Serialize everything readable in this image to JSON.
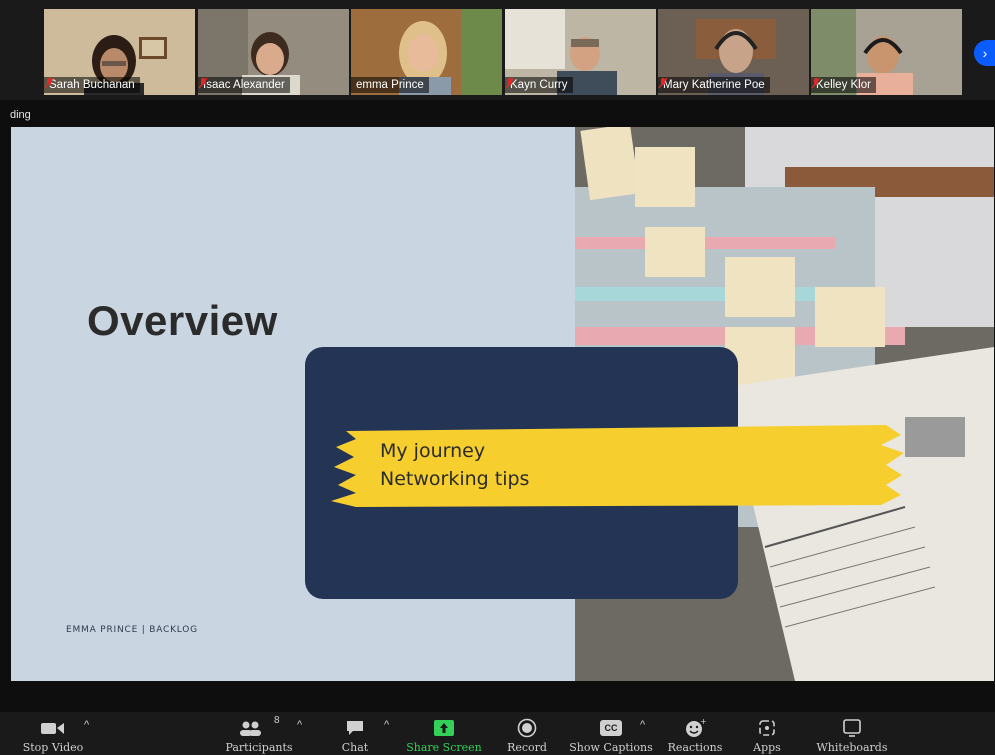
{
  "participants": [
    {
      "name": "Sarah Buchanan",
      "muted": true,
      "bg": "#c9b79a"
    },
    {
      "name": "Isaac Alexander",
      "muted": true,
      "bg": "#8f8a7e"
    },
    {
      "name": "emma Prince",
      "muted": false,
      "bg": "#9b6a3c"
    },
    {
      "name": "Kayn Curry",
      "muted": true,
      "bg": "#b9b3a3"
    },
    {
      "name": "Mary Katherine Poe",
      "muted": true,
      "bg": "#6e6255"
    },
    {
      "name": "Kelley Klor",
      "muted": true,
      "bg": "#a7a295"
    }
  ],
  "strip": {
    "next_arrow": "›"
  },
  "recording_label": "ding",
  "slide": {
    "title": "Overview",
    "items": [
      "My journey",
      "Networking tips"
    ],
    "footer": "EMMA PRINCE | BACKLOG"
  },
  "toolbar": {
    "stop_video": "Stop Video",
    "participants": "Participants",
    "participants_count": "8",
    "chat": "Chat",
    "share_screen": "Share Screen",
    "record": "Record",
    "show_captions": "Show Captions",
    "captions_badge": "CC",
    "reactions": "Reactions",
    "apps": "Apps",
    "whiteboards": "Whiteboards"
  },
  "colors": {
    "accent_green": "#33d05a",
    "active_speaker": "#8ac43f",
    "navy": "#233454",
    "highlight": "#f6cf2e",
    "slide_bg": "#c9d6e2"
  }
}
